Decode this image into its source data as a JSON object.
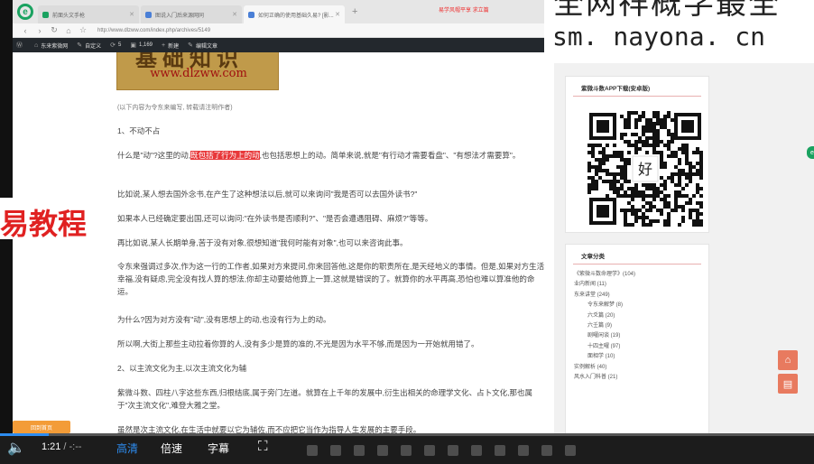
{
  "browser": {
    "tabs": [
      {
        "label": "前面头文手枪",
        "color": "#1aa260"
      },
      {
        "label": "图说入门后来源网同",
        "color": "#4a7fd6"
      },
      {
        "label": "如何正确的使用基础久易? [影...",
        "color": "#4a7fd6",
        "active": true
      }
    ],
    "tab_annotation": "易学风帽平享 求立篇",
    "url": "http://www.dlzww.com/index.php/archives/5149"
  },
  "wp_admin_bar": {
    "items": [
      {
        "icon": "wp-logo",
        "label": ""
      },
      {
        "icon": "home",
        "label": "东来紫微网"
      },
      {
        "icon": "brush",
        "label": "自定义"
      },
      {
        "icon": "refresh",
        "label": "5"
      },
      {
        "icon": "comment",
        "label": "1,169"
      },
      {
        "icon": "plus",
        "label": "新建"
      },
      {
        "icon": "pencil",
        "label": "编辑文章"
      }
    ]
  },
  "article": {
    "banner_top": "基础知识",
    "banner_url": "www.dlzww.com",
    "note": "(以下内容为令东来编写, 转载请注明作者)",
    "heading1": "1、不动不占",
    "p1_before": "什么是\"动\"?这里的动,",
    "p1_highlight": "既包括了行为上的动",
    "p1_after": ",也包括思想上的动。简单来说,就是\"有行动才需要看盘\"、\"有想法才需要算\"。",
    "p2": "比如说,某人想去国外念书,在产生了这种想法以后,就可以来询问\"我是否可以去国外读书?\"",
    "p3": "如果本人已经确定要出国,还可以询问:\"在外读书是否顺利?\"、\"是否会遭遇阻碍、麻烦?\"等等。",
    "p4": "再比如说,某人长期单身,苦于没有对象,很想知道\"我何时能有对象\",也可以来咨询此事。",
    "p5": "令东来强调过多次,作为这一行的工作者,如果对方来提问,你来回答他,这是你的职责所在,是天经地义的事情。但是,如果对方生活幸福,没有疑虑,完全没有找人算的想法,你却主动要给他算上一算,这就是错误的了。就算你的水平再高,恐怕也难以算准他的命运。",
    "p6": "为什么?因为对方没有\"动\",没有思想上的动,也没有行为上的动。",
    "p7": "所以啊,大街上那些主动拉着你算的人,没有多少是算的准的,不光是因为水平不够,而是因为一开始就用错了。",
    "heading2": "2、以主流文化为主,以次主流文化为辅",
    "p8": "紫微斗数、四柱八字这些东西,归根结底,属于旁门左道。就算在上千年的发展中,衍生出相关的命理学文化、占卜文化,那也属于\"次主流文化\",难登大雅之堂。",
    "p9": "虽然是次主流文化,在生活中就要以它为辅佐,而不应把它当作为指导人生发展的主要手段。",
    "pill_button": "回到首页"
  },
  "overlays": {
    "top_right_line1": "全网祥概学最全",
    "top_right_line2": "sm. nayona. cn",
    "left_text": "易教程"
  },
  "sidebar": {
    "app_widget_title": "紫微斗数APP下载(安卓版)",
    "qr_label": "好",
    "category_title": "文章分类",
    "categories": [
      {
        "label": "《紫微斗数命理学》(104)",
        "sub": false
      },
      {
        "label": "业内新闻 (11)",
        "sub": false
      },
      {
        "label": "东来讲堂 (249)",
        "sub": false
      },
      {
        "label": "令东来解梦 (8)",
        "sub": true
      },
      {
        "label": "六爻篇 (20)",
        "sub": true
      },
      {
        "label": "六壬篇 (9)",
        "sub": true
      },
      {
        "label": "剧曜闲谈 (19)",
        "sub": true
      },
      {
        "label": "十四主曜 (97)",
        "sub": true
      },
      {
        "label": "面相学 (10)",
        "sub": true
      },
      {
        "label": "实例解析 (40)",
        "sub": false
      },
      {
        "label": "风水入门科普 (21)",
        "sub": false
      }
    ]
  },
  "video": {
    "current_time": "1:21",
    "separator": "/",
    "duration": "-:--",
    "quality_label": "高清",
    "speed_label": "倍速",
    "subtitle_label": "字幕",
    "progress_fraction": 0.06,
    "accent": "#2d8cf0"
  }
}
